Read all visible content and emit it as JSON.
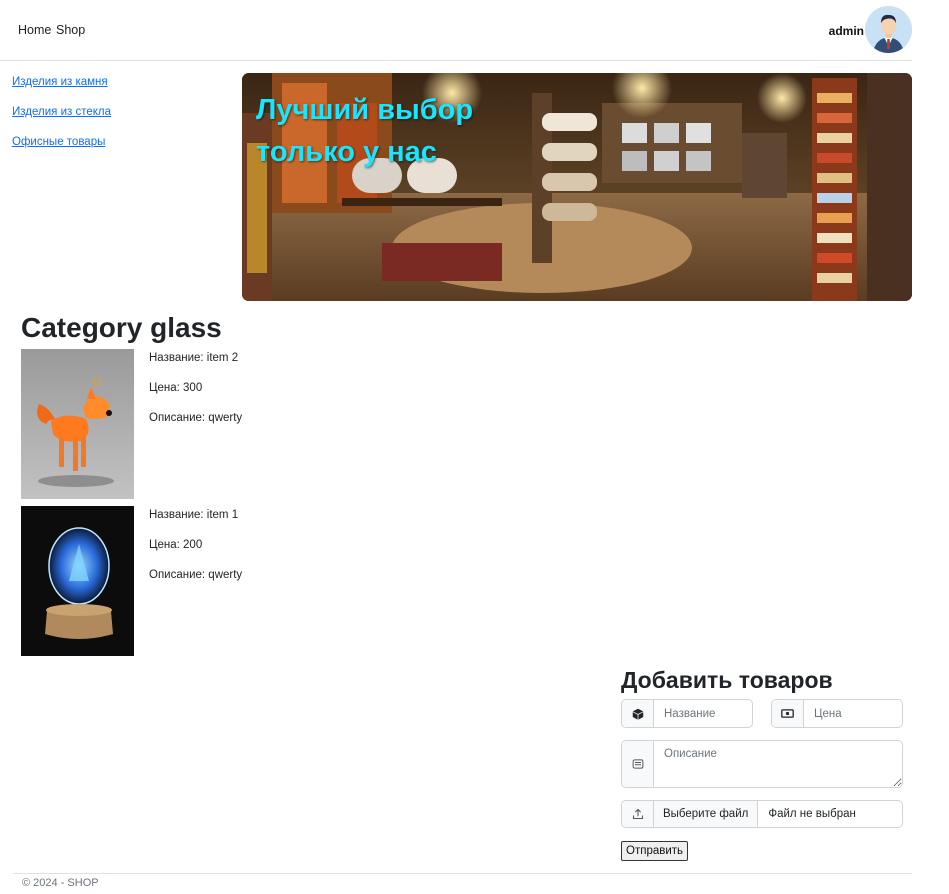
{
  "nav": {
    "home": "Home",
    "shop": "Shop",
    "username": "admin"
  },
  "sidebar": {
    "items": [
      {
        "label": "Изделия из камня"
      },
      {
        "label": "Изделия из стекла"
      },
      {
        "label": "Офисные товары"
      }
    ]
  },
  "banner": {
    "line1": "Лучший выбор",
    "line2": "только у нас"
  },
  "category": {
    "title": "Category glass"
  },
  "products": [
    {
      "name": "Название: item 2",
      "price": "Цена: 300",
      "description": "Описание: qwerty",
      "image_icon": "glass-fox-figurine"
    },
    {
      "name": "Название: item 1",
      "price": "Цена: 200",
      "description": "Описание: qwerty",
      "image_icon": "glass-crystal-ball"
    }
  ],
  "form": {
    "title": "Добавить товаров",
    "name_placeholder": "Название",
    "price_placeholder": "Цена",
    "description_placeholder": "Описание",
    "file_button": "Выберите файл",
    "file_status": "Файл не выбран",
    "submit": "Отправить"
  },
  "footer": {
    "text": "© 2024 - SHOP"
  },
  "colors": {
    "link": "#0d6efd",
    "banner_text": "#16e6ff",
    "border": "#dee2e6"
  }
}
